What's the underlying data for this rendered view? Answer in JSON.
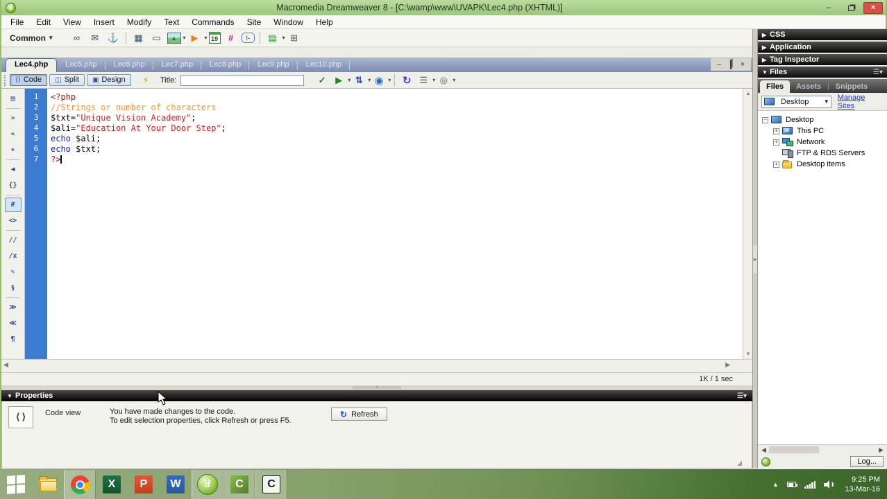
{
  "window": {
    "title": "Macromedia Dreamweaver 8 - [C:\\wamp\\www\\UVAPK\\Lec4.php (XHTML)]"
  },
  "menu": {
    "items": [
      "File",
      "Edit",
      "View",
      "Insert",
      "Modify",
      "Text",
      "Commands",
      "Site",
      "Window",
      "Help"
    ]
  },
  "insert_bar": {
    "category": "Common",
    "icons": [
      "hyperlink",
      "email-link",
      "named-anchor",
      "table",
      "insert-div",
      "images",
      "media",
      "date",
      "server-include",
      "comment",
      "templates",
      "tag-chooser"
    ]
  },
  "document": {
    "tabs": [
      {
        "label": "Lec4.php",
        "active": true
      },
      {
        "label": "Lec5.php",
        "active": false
      },
      {
        "label": "Lec6.php",
        "active": false
      },
      {
        "label": "Lec7.php",
        "active": false
      },
      {
        "label": "Lec8.php",
        "active": false
      },
      {
        "label": "Lec9.php",
        "active": false
      },
      {
        "label": "Lec10.php",
        "active": false
      }
    ]
  },
  "doc_toolbar": {
    "code_label": "Code",
    "split_label": "Split",
    "design_label": "Design",
    "title_label": "Title:",
    "title_value": "",
    "icons": [
      "check-page",
      "preview-debug",
      "file-management",
      "browser-globe",
      "refresh-design-view",
      "view-options",
      "visual-aids"
    ]
  },
  "coding_toolbar": {
    "icons": [
      "open-documents",
      "collapse-full-tag",
      "collapse-selection",
      "expand-all",
      "select-parent-tag",
      "balance-braces",
      "line-numbers",
      "highlight-invalid-code",
      "apply-comment",
      "remove-comment",
      "wrap-tag",
      "recent-snippets",
      "indent-code",
      "outdent-code",
      "format-source-code"
    ],
    "selected": "line-numbers"
  },
  "code": {
    "lines": [
      {
        "n": "1",
        "seg": [
          [
            "<?php",
            "php"
          ]
        ],
        "caret": false
      },
      {
        "n": "2",
        "seg": [
          [
            "//Strings or number of characters",
            "com"
          ]
        ],
        "caret": false
      },
      {
        "n": "3",
        "seg": [
          [
            "$txt=",
            "pln"
          ],
          [
            "\"Unique Vision Academy\"",
            "str"
          ],
          [
            ";",
            "pln"
          ]
        ],
        "caret": false
      },
      {
        "n": "4",
        "seg": [
          [
            "$ali=",
            "pln"
          ],
          [
            "\"Education At Your Door Step\"",
            "str"
          ],
          [
            ";",
            "pln"
          ]
        ],
        "caret": false
      },
      {
        "n": "5",
        "seg": [
          [
            "echo ",
            "kw"
          ],
          [
            "$ali;",
            "pln"
          ]
        ],
        "caret": false
      },
      {
        "n": "6",
        "seg": [
          [
            "echo ",
            "kw"
          ],
          [
            "$txt;",
            "pln"
          ]
        ],
        "caret": false
      },
      {
        "n": "7",
        "seg": [
          [
            "?>",
            "php"
          ]
        ],
        "caret": true
      }
    ]
  },
  "status_bar": {
    "size_time": "1K / 1 sec"
  },
  "properties_panel": {
    "title": "Properties",
    "view_label": "Code view",
    "message_line1": "You have made changes to the code.",
    "message_line2": "To edit selection properties, click Refresh or press F5.",
    "refresh_label": "Refresh"
  },
  "dock": {
    "collapsed_panels": [
      "CSS",
      "Application",
      "Tag Inspector"
    ],
    "files_panel": {
      "title": "Files",
      "tabs": [
        {
          "label": "Files",
          "active": true
        },
        {
          "label": "Assets",
          "active": false
        },
        {
          "label": "Snippets",
          "active": false
        }
      ],
      "site": "Desktop",
      "manage_sites": "Manage Sites",
      "tree": [
        {
          "label": "Desktop",
          "icon": "desktop",
          "expander": "minus",
          "level": 0
        },
        {
          "label": "This PC",
          "icon": "computer",
          "expander": "plus",
          "level": 1
        },
        {
          "label": "Network",
          "icon": "network",
          "expander": "plus",
          "level": 1
        },
        {
          "label": "FTP & RDS Servers",
          "icon": "server",
          "expander": "none",
          "level": 1
        },
        {
          "label": "Desktop items",
          "icon": "folder",
          "expander": "plus",
          "level": 1
        }
      ],
      "log_button": "Log..."
    }
  },
  "taskbar": {
    "buttons": [
      {
        "name": "start",
        "active": false
      },
      {
        "name": "file-explorer",
        "active": false
      },
      {
        "name": "chrome",
        "active": true
      },
      {
        "name": "excel",
        "active": false
      },
      {
        "name": "powerpoint",
        "active": false
      },
      {
        "name": "word",
        "active": false
      },
      {
        "name": "dreamweaver",
        "active": true
      },
      {
        "name": "camtasia",
        "active": true
      },
      {
        "name": "camtasia-recorder",
        "active": true
      }
    ],
    "clock_time": "9:25 PM",
    "clock_date": "13-Mar-16"
  }
}
